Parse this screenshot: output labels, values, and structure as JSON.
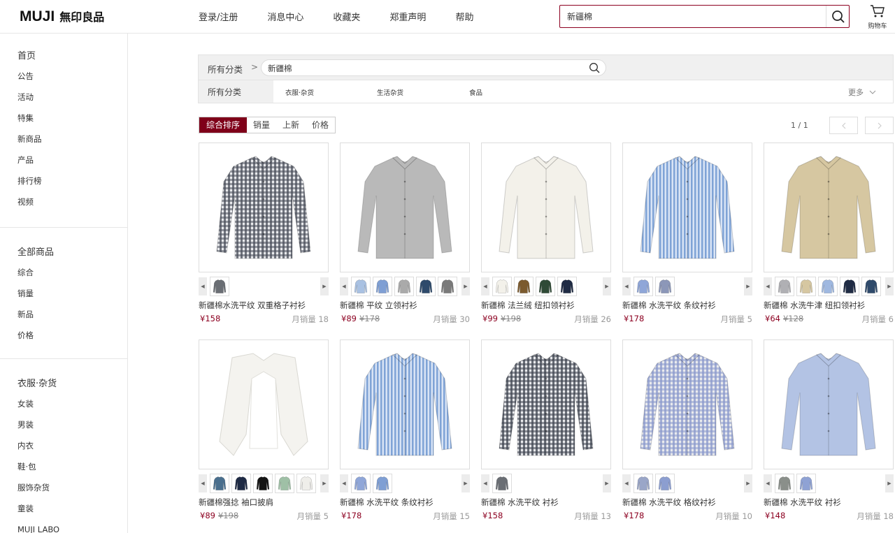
{
  "header": {
    "logo_en": "MUJI",
    "logo_cn": "無印良品",
    "nav": [
      "登录/注册",
      "消息中心",
      "收藏夹",
      "郑重声明",
      "帮助"
    ],
    "search_value": "新疆棉",
    "cart_label": "购物车"
  },
  "sidebar": {
    "group1": {
      "head": "首页",
      "items": [
        "公告",
        "活动",
        "特集",
        "新商品",
        "产品",
        "排行榜",
        "视频"
      ]
    },
    "group2": {
      "head": "全部商品",
      "items": [
        "综合",
        "销量",
        "新品",
        "价格"
      ]
    },
    "group3": {
      "head": "衣服·杂货",
      "items": [
        "女装",
        "男装",
        "内衣",
        "鞋·包",
        "服饰杂货",
        "童装",
        "MUJI LABO"
      ]
    }
  },
  "filter": {
    "crumb": "所有分类",
    "chev": ">",
    "keyword": "新疆棉",
    "row_label": "所有分类",
    "categories": [
      "衣服·杂货",
      "生活杂货",
      "食品"
    ],
    "more": "更多"
  },
  "sort": {
    "options": [
      "综合排序",
      "销量",
      "上新",
      "价格"
    ],
    "active": "综合排序",
    "page_text": "1 / 1"
  },
  "colors": {
    "accent": "#7f0019",
    "price": "#8c0020"
  },
  "products": [
    {
      "name": "新疆棉水洗平纹 双重格子衬衫",
      "price": "¥158",
      "old_price": "",
      "sales": "月销量 18",
      "main_color": "#4a4f5a",
      "pattern": "check",
      "swatches": [
        "#6a6e74"
      ]
    },
    {
      "name": "新疆棉 平纹 立领衬衫",
      "price": "¥89",
      "old_price": "¥178",
      "sales": "月销量 30",
      "main_color": "#b9b9b9",
      "pattern": "plain",
      "swatches": [
        "#a9c1e2",
        "#7f9fd4",
        "#aaaaaa",
        "#2e4a6b",
        "#7a7a7a"
      ]
    },
    {
      "name": "新疆棉 法兰绒 纽扣领衬衫",
      "price": "¥99",
      "old_price": "¥198",
      "sales": "月销量 26",
      "main_color": "#f3f1ea",
      "pattern": "plain",
      "swatches": [
        "#f3f1ea",
        "#7b5a2e",
        "#2f4a36",
        "#1f2b44"
      ]
    },
    {
      "name": "新疆棉 水洗平纹 条纹衬衫",
      "price": "¥178",
      "old_price": "",
      "sales": "月销量 5",
      "main_color": "#7fa3d6",
      "pattern": "stripe",
      "swatches": [
        "#8fa6d8",
        "#8c97b8"
      ]
    },
    {
      "name": "新疆棉 水洗牛津 纽扣领衬衫",
      "price": "¥64",
      "old_price": "¥128",
      "sales": "月销量 6",
      "main_color": "#d6c7a1",
      "pattern": "plain",
      "swatches": [
        "#b0b0b4",
        "#d6c7a1",
        "#9fb8e0",
        "#1f2b44",
        "#2f4a6b"
      ]
    },
    {
      "name": "新疆棉强捻 袖口披肩",
      "price": "¥89",
      "old_price": "¥198",
      "sales": "月销量 5",
      "main_color": "#f4f3ef",
      "pattern": "cape",
      "swatches": [
        "#4a6f8e",
        "#1e2a44",
        "#141414",
        "#9fc0a6",
        "#efeeea"
      ]
    },
    {
      "name": "新疆棉 水洗平纹 条纹衬衫",
      "price": "¥178",
      "old_price": "",
      "sales": "月销量 15",
      "main_color": "#7fa3d6",
      "pattern": "stripe",
      "swatches": [
        "#8fa6d8",
        "#7f9fd4"
      ]
    },
    {
      "name": "新疆棉 水洗平纹 衬衫",
      "price": "¥158",
      "old_price": "",
      "sales": "月销量 13",
      "main_color": "#3f4450",
      "pattern": "check",
      "swatches": [
        "#6a6e74"
      ]
    },
    {
      "name": "新疆棉 水洗平纹 格纹衬衫",
      "price": "¥178",
      "old_price": "",
      "sales": "月销量 10",
      "main_color": "#8a98cc",
      "pattern": "check",
      "swatches": [
        "#9aa6c8",
        "#8c9ed0"
      ]
    },
    {
      "name": "新疆棉 水洗平纹 衬衫",
      "price": "¥148",
      "old_price": "",
      "sales": "月销量 18",
      "main_color": "#b3c3e4",
      "pattern": "plain",
      "swatches": [
        "#8a8f8a",
        "#8fa2d4"
      ]
    }
  ]
}
